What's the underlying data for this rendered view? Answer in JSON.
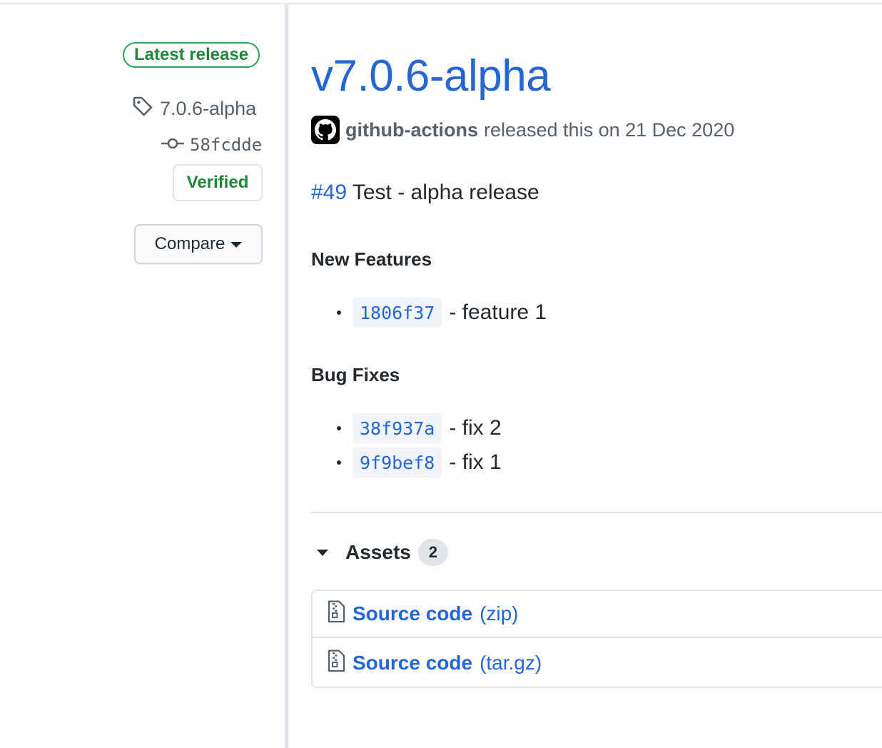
{
  "sidebar": {
    "latest_badge": "Latest release",
    "tag": "7.0.6-alpha",
    "commit": "58fcdde",
    "verified": "Verified",
    "compare": "Compare"
  },
  "release": {
    "title": "v7.0.6-alpha",
    "author": "github-actions",
    "byline_text": "released this on 21 Dec 2020",
    "pr_ref": "#49",
    "pr_text": "Test - alpha release",
    "sections": [
      {
        "heading": "New Features",
        "items": [
          {
            "sha": "1806f37",
            "text": "- feature 1"
          }
        ]
      },
      {
        "heading": "Bug Fixes",
        "items": [
          {
            "sha": "38f937a",
            "text": "- fix 2"
          },
          {
            "sha": "9f9bef8",
            "text": "- fix 1"
          }
        ]
      }
    ]
  },
  "assets": {
    "label": "Assets",
    "count": "2",
    "items": [
      {
        "name": "Source code",
        "ext": "(zip)"
      },
      {
        "name": "Source code",
        "ext": "(tar.gz)"
      }
    ]
  },
  "colors": {
    "link": "#2566d4",
    "success": "#22863a",
    "border": "#e1e4e8"
  },
  "icons": [
    "tag-icon",
    "commit-icon",
    "caret-down-icon",
    "github-logo-icon",
    "triangle-down-icon",
    "file-zip-icon"
  ]
}
